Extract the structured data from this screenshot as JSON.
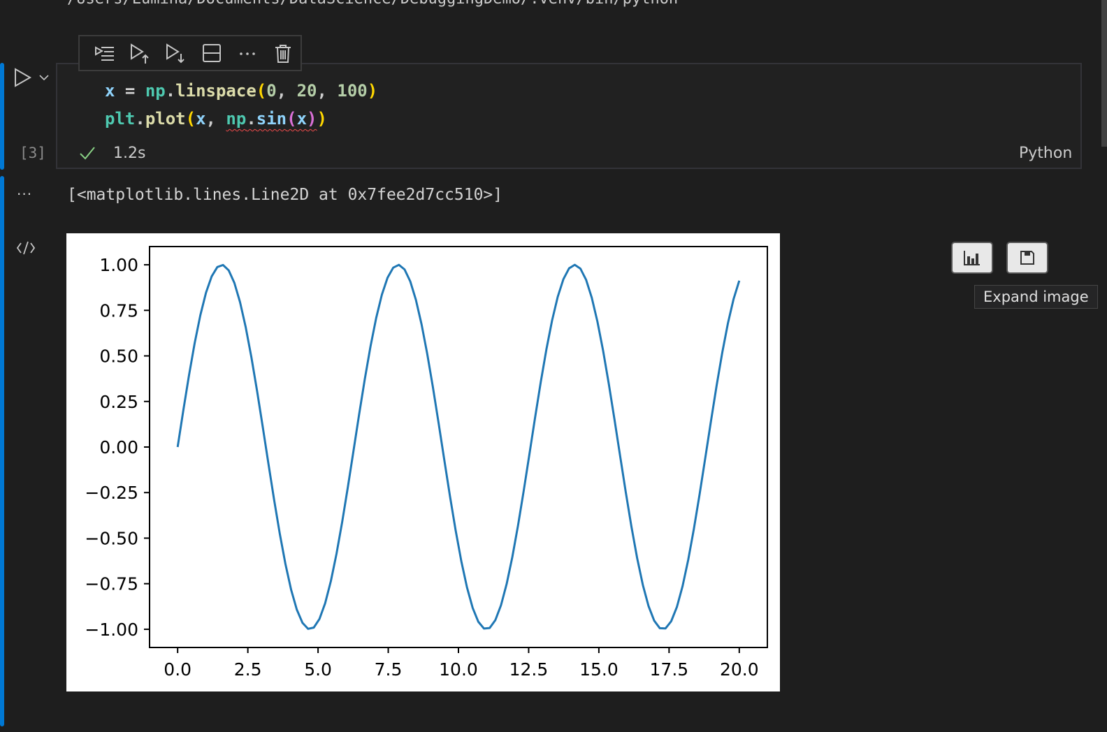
{
  "previous_output": {
    "text": "/Users/Lumina/Documents/DataScience/DebuggingDemo/.venv/bin/python"
  },
  "cell_toolbar": {
    "buttons": [
      {
        "name": "execute-above-and-cell",
        "icon": "run-all-lines-icon"
      },
      {
        "name": "execute-above",
        "icon": "run-above-icon"
      },
      {
        "name": "execute-below",
        "icon": "run-below-icon"
      },
      {
        "name": "split-cell",
        "icon": "split-cell-icon"
      },
      {
        "name": "more-actions",
        "icon": "ellipsis-icon"
      },
      {
        "name": "delete-cell",
        "icon": "trash-icon"
      }
    ]
  },
  "cell": {
    "execution_count": "[3]",
    "status_time": "1.2s",
    "status": "success",
    "language": "Python",
    "code": {
      "line1": {
        "var": "x",
        "eq": " = ",
        "mod": "np",
        "dot": ".",
        "fn": "linspace",
        "open": "(",
        "a1": "0",
        "sep1": ", ",
        "a2": "20",
        "sep2": ", ",
        "a3": "100",
        "close": ")"
      },
      "line2": {
        "mod": "plt",
        "dot": ".",
        "fn": "plot",
        "open": "(",
        "a1": "x",
        "sep": ", ",
        "mod2": "np",
        "dot2": ".",
        "fn2": "sin",
        "open2": "(",
        "a2": "x",
        "close2": ")",
        "close": ")"
      }
    }
  },
  "output": {
    "more_label": "···",
    "text": "[<matplotlib.lines.Line2D at 0x7fee2d7cc510>]",
    "image_actions": [
      {
        "name": "plot-viewer",
        "icon": "bar-chart-icon"
      },
      {
        "name": "save-image",
        "icon": "save-icon"
      }
    ],
    "tooltip": "Expand image"
  },
  "colors": {
    "accent": "#0078d4",
    "line": "#1f77b4",
    "check": "#89d185"
  },
  "chart_data": {
    "type": "line",
    "title": "",
    "xlabel": "",
    "ylabel": "",
    "function": "y = sin(x), x = linspace(0, 20, 100)",
    "x_start": 0,
    "x_end": 20,
    "num_points": 100,
    "xlim": [
      -1.0,
      21.0
    ],
    "ylim": [
      -1.1,
      1.1
    ],
    "x_ticks": [
      0.0,
      2.5,
      5.0,
      7.5,
      10.0,
      12.5,
      15.0,
      17.5,
      20.0
    ],
    "x_tick_labels": [
      "0.0",
      "2.5",
      "5.0",
      "7.5",
      "10.0",
      "12.5",
      "15.0",
      "17.5",
      "20.0"
    ],
    "y_ticks": [
      1.0,
      0.75,
      0.5,
      0.25,
      0.0,
      -0.25,
      -0.5,
      -0.75,
      -1.0
    ],
    "y_tick_labels": [
      "1.00",
      "0.75",
      "0.50",
      "0.25",
      "0.00",
      "−0.25",
      "−0.50",
      "−0.75",
      "−1.00"
    ],
    "grid": false,
    "series": [
      {
        "name": "sin(x)",
        "color": "#1f77b4"
      }
    ]
  }
}
